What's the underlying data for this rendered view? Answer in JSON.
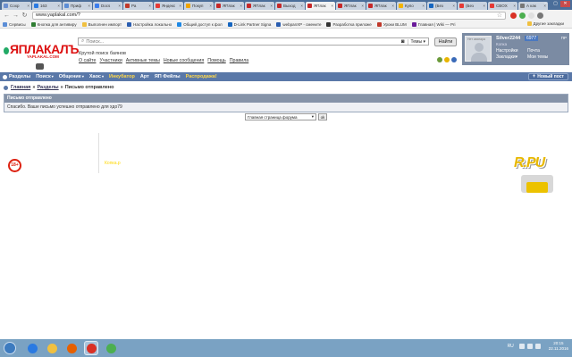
{
  "browser": {
    "tabs": [
      {
        "title": "Сохр",
        "color": "#6b8fcf"
      },
      {
        "title": "163",
        "color": "#2a7ae2"
      },
      {
        "title": "Приф",
        "color": "#5b8dd6"
      },
      {
        "title": "Docs",
        "color": "#3b7ded"
      },
      {
        "title": "Ра",
        "color": "#c0392b"
      },
      {
        "title": "Яндекс",
        "color": "#e53935"
      },
      {
        "title": "Покуп",
        "color": "#f0a500"
      },
      {
        "title": "ЯПлак",
        "color": "#c62828"
      },
      {
        "title": "ЯПлак",
        "color": "#c62828"
      },
      {
        "title": "Выход",
        "color": "#c62828"
      },
      {
        "title": "ЯПлак",
        "color": "#c62828",
        "active": true
      },
      {
        "title": "ЯПлак",
        "color": "#c62828"
      },
      {
        "title": "ЯПлак",
        "color": "#c62828"
      },
      {
        "title": "Купо",
        "color": "#f4b400"
      },
      {
        "title": "(Без",
        "color": "#1565c0"
      },
      {
        "title": "(Без",
        "color": "#e53935"
      },
      {
        "title": "CBOX",
        "color": "#e53935"
      },
      {
        "title": "А как",
        "color": "#777777"
      }
    ],
    "url": "www.yaplakal.com/?",
    "bookmarks": [
      {
        "label": "Сервисы",
        "color": "#5b8dd6"
      },
      {
        "label": "Кнопка для антивиру",
        "color": "#2e7d32"
      },
      {
        "label": "Выполнен импорт",
        "color": "#f0c040"
      },
      {
        "label": "Настройка локально",
        "color": "#2a5db0"
      },
      {
        "label": "Общий доступ к фол",
        "color": "#1e88e5"
      },
      {
        "label": "D-Link Partner Signa",
        "color": "#1565c0"
      },
      {
        "label": "webpanXP - смените",
        "color": "#2a5db0"
      },
      {
        "label": "Разработка приложе",
        "color": "#333333"
      },
      {
        "label": "Уроки BLUM",
        "color": "#c0392b"
      },
      {
        "label": "Главная | Wiki — Pri",
        "color": "#6a1b9a"
      }
    ],
    "other_bookmarks": "Другие закладки"
  },
  "site": {
    "logo": "ЯПЛАКАЛЪ",
    "logo_sub": "YAPLAKAL.COM",
    "search_placeholder": "Поиск...",
    "search_scope": "Темы",
    "search_button": "Найти",
    "tagline": "Крутой поиск баянов",
    "header_links": [
      "О сайте",
      "Участники",
      "Активные темы",
      "Новые сообщения",
      "Помощь",
      "Правила"
    ],
    "user": {
      "avatar_caption": "Нет аватара",
      "name": "Silver2244",
      "karma": "6977",
      "rank": "Копка",
      "pm": "ПР",
      "links": {
        "settings": "Настройки",
        "mail": "Почта",
        "bookmarks": "Закладки",
        "my_topics": "Мои темы"
      }
    },
    "nav": [
      {
        "label": "Разделы",
        "caret": false
      },
      {
        "label": "Поиск",
        "caret": true
      },
      {
        "label": "Общение",
        "caret": true
      },
      {
        "label": "Хаос",
        "caret": true
      },
      {
        "label": "Инкубатор",
        "caret": false,
        "yellow": true
      },
      {
        "label": "Арт",
        "caret": false
      },
      {
        "label": "ЯП Фейлы",
        "caret": false
      },
      {
        "label": "Распродажа!",
        "caret": false,
        "yellow": true
      }
    ],
    "new_post": "Новый пост",
    "breadcrumb": {
      "home": "Главная",
      "sections": "Разделы",
      "current": "Письмо отправлено"
    },
    "message": {
      "title": "Письмо отправлено",
      "body": "Спасибо. Ваше письмо успешно отправлено для хдо79"
    },
    "jump": {
      "selected": "Главная страница форума",
      "go": "ok"
    },
    "age_badge": "18+",
    "yellow_text": "Копка.р"
  },
  "taskbar": {
    "apps": [
      {
        "name": "ie",
        "color": "#2a7ae2"
      },
      {
        "name": "explorer",
        "color": "#f0c040"
      },
      {
        "name": "firefox",
        "color": "#e66000"
      },
      {
        "name": "chrome",
        "color": "#d93025",
        "active": true
      },
      {
        "name": "utorrent",
        "color": "#4caf50"
      }
    ],
    "lang": "RU",
    "time": "20:15",
    "date": "22.11.2016"
  }
}
